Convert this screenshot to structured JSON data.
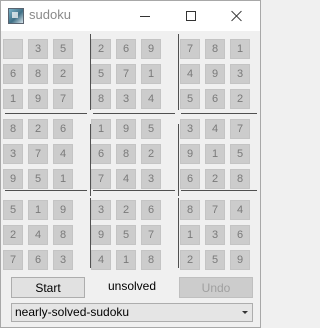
{
  "window": {
    "title": "sudoku"
  },
  "board": {
    "rows": [
      [
        "",
        "3",
        "5",
        "2",
        "6",
        "9",
        "7",
        "8",
        "1"
      ],
      [
        "6",
        "8",
        "2",
        "5",
        "7",
        "1",
        "4",
        "9",
        "3"
      ],
      [
        "1",
        "9",
        "7",
        "8",
        "3",
        "4",
        "5",
        "6",
        "2"
      ],
      [
        "8",
        "2",
        "6",
        "1",
        "9",
        "5",
        "3",
        "4",
        "7"
      ],
      [
        "3",
        "7",
        "4",
        "6",
        "8",
        "2",
        "9",
        "1",
        "5"
      ],
      [
        "9",
        "5",
        "1",
        "7",
        "4",
        "3",
        "6",
        "2",
        "8"
      ],
      [
        "5",
        "1",
        "9",
        "3",
        "2",
        "6",
        "8",
        "7",
        "4"
      ],
      [
        "2",
        "4",
        "8",
        "9",
        "5",
        "7",
        "1",
        "3",
        "6"
      ],
      [
        "7",
        "6",
        "3",
        "4",
        "1",
        "8",
        "2",
        "5",
        "9"
      ]
    ]
  },
  "controls": {
    "start_label": "Start",
    "status_text": "unsolved",
    "undo_label": "Undo",
    "puzzle_selected": "nearly-solved-sudoku"
  },
  "icons": {
    "app": "sudoku-app-icon",
    "minimize": "minimize-icon",
    "maximize": "maximize-icon",
    "close": "close-icon",
    "dropdown": "chevron-down-icon"
  }
}
